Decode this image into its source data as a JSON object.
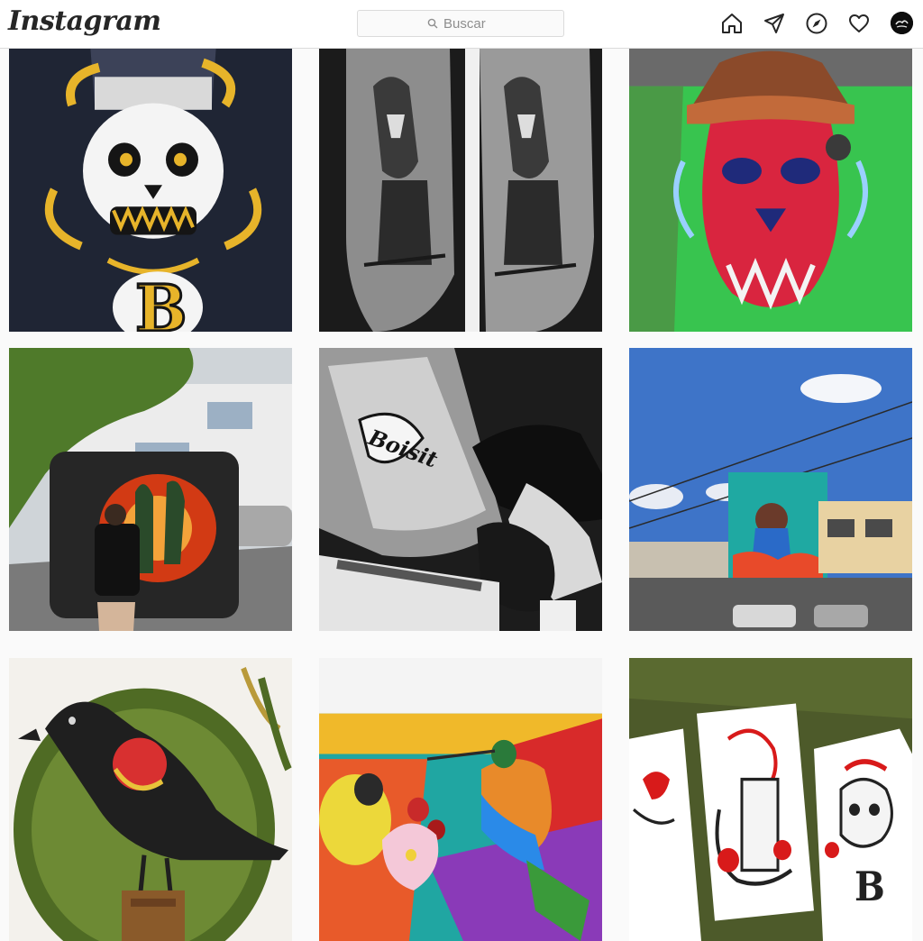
{
  "app": {
    "logo_text": "Instagram"
  },
  "search": {
    "placeholder": "Buscar",
    "value": ""
  },
  "nav": {
    "icons": [
      "home-icon",
      "direct-message-icon",
      "explore-icon",
      "activity-heart-icon",
      "profile-avatar"
    ]
  },
  "grid": {
    "posts": [
      {
        "subject": "skull-with-beanie-illustration-on-black-shirt",
        "colors": [
          "#1c2432",
          "#e8b52a",
          "#f2f2f2"
        ]
      },
      {
        "subject": "samurai-tattoo-on-arm-black-and-grey",
        "colors": [
          "#2b2b2b",
          "#9a9a9a"
        ]
      },
      {
        "subject": "red-skull-graffiti-mural-on-green-wall",
        "colors": [
          "#2bbf4a",
          "#d72a4a",
          "#3a2a1a"
        ]
      },
      {
        "subject": "artist-painting-cactus-mural-on-trailer",
        "colors": [
          "#2c2c2c",
          "#d24a1e",
          "#8fb27a"
        ]
      },
      {
        "subject": "tattoo-artist-at-work-black-and-white",
        "colors": [
          "#111111",
          "#d0d0d0"
        ]
      },
      {
        "subject": "street-mural-on-building-under-blue-sky",
        "colors": [
          "#4a78c8",
          "#2aa0a0",
          "#e8e2d0"
        ]
      },
      {
        "subject": "red-winged-blackbird-mural",
        "colors": [
          "#f5f3ee",
          "#2a2a2a",
          "#d83030",
          "#5a7a2a"
        ]
      },
      {
        "subject": "colorful-birds-and-flowers-mural",
        "colors": [
          "#1ea3a0",
          "#f0b020",
          "#d52b2b"
        ]
      },
      {
        "subject": "red-ink-skull-drawings-on-grass",
        "colors": [
          "#4a5a2a",
          "#ffffff",
          "#cc1a1a"
        ]
      }
    ]
  }
}
